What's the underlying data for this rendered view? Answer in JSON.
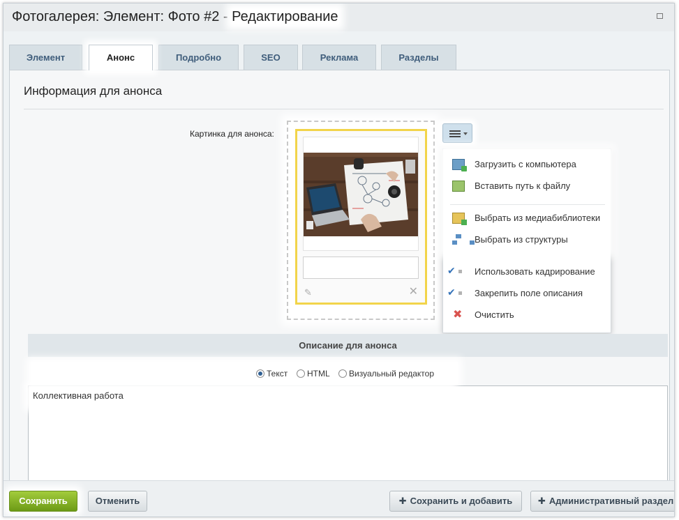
{
  "window": {
    "title_prefix": "Фотогалерея: Элемент: Фото #2 - ",
    "title_highlight": "Редактирование"
  },
  "tabs": [
    {
      "label": "Элемент"
    },
    {
      "label": "Анонс"
    },
    {
      "label": "Подробно"
    },
    {
      "label": "SEO"
    },
    {
      "label": "Реклама"
    },
    {
      "label": "Разделы"
    }
  ],
  "section": {
    "title": "Информация для анонса",
    "picture_label": "Картинка для анонса:"
  },
  "menu": {
    "items": [
      {
        "label": "Загрузить с компьютера",
        "icon": "computer-upload-icon"
      },
      {
        "label": "Вставить путь к файлу",
        "icon": "file-path-icon"
      },
      {
        "label": "Выбрать из медиабиблиотеки",
        "icon": "media-library-icon"
      },
      {
        "label": "Выбрать из структуры",
        "icon": "structure-icon"
      },
      {
        "label": "Использовать кадрирование",
        "icon": "check-icon"
      },
      {
        "label": "Закрепить поле описания",
        "icon": "check-icon"
      },
      {
        "label": "Очистить",
        "icon": "clear-icon"
      }
    ]
  },
  "description": {
    "header": "Описание для анонса",
    "mode_options": [
      "Текст",
      "HTML",
      "Визуальный редактор"
    ],
    "selected_mode": "Текст",
    "text": "Коллективная работа"
  },
  "footer": {
    "save": "Сохранить",
    "cancel": "Отменить",
    "save_add": "Сохранить и добавить",
    "admin": "Административный раздел"
  },
  "colors": {
    "accent_save": "#7aa920",
    "tab_text": "#3f5d7b",
    "file_frame": "#f2d44a"
  }
}
